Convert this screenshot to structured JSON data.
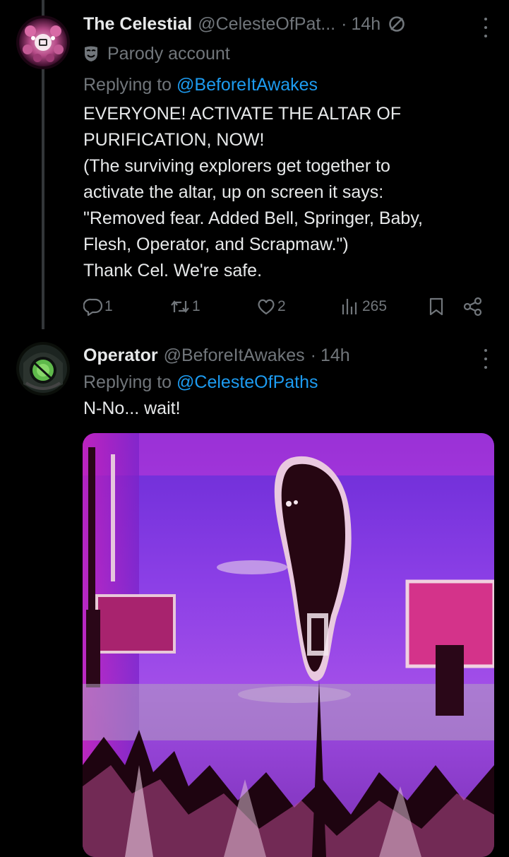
{
  "tweets": [
    {
      "display_name": "The Celestial",
      "handle": "@CelesteOfPat...",
      "separator": "·",
      "time": "14h",
      "parody_label": "Parody account",
      "replying_prefix": "Replying to",
      "replying_to": "@BeforeItAwakes",
      "text": "EVERYONE! ACTIVATE THE ALTAR OF\nPURIFICATION, NOW!\n(The surviving explorers get together to\nactivate the altar, up on screen it says:\n\"Removed fear. Added Bell, Springer, Baby,\nFlesh, Operator, and Scrapmaw.\")\nThank Cel. We're safe.",
      "replies": "1",
      "reposts": "1",
      "likes": "2",
      "views": "265"
    },
    {
      "display_name": "Operator",
      "handle": "@BeforeItAwakes",
      "separator": "·",
      "time": "14h",
      "replying_prefix": "Replying to",
      "replying_to": "@CelesteOfPaths",
      "text": "N-No... wait!"
    }
  ],
  "icons": {
    "more": "more-icon",
    "no-sign": "no-sign-icon",
    "mask": "parody-mask-icon",
    "reply": "reply-icon",
    "repost": "repost-icon",
    "like": "heart-icon",
    "views": "views-icon",
    "bookmark": "bookmark-icon",
    "share": "share-icon"
  },
  "colors": {
    "background": "#000000",
    "text": "#e7e9ea",
    "secondary": "#71767b",
    "link": "#1d9bf0",
    "thread_line": "#333639"
  }
}
